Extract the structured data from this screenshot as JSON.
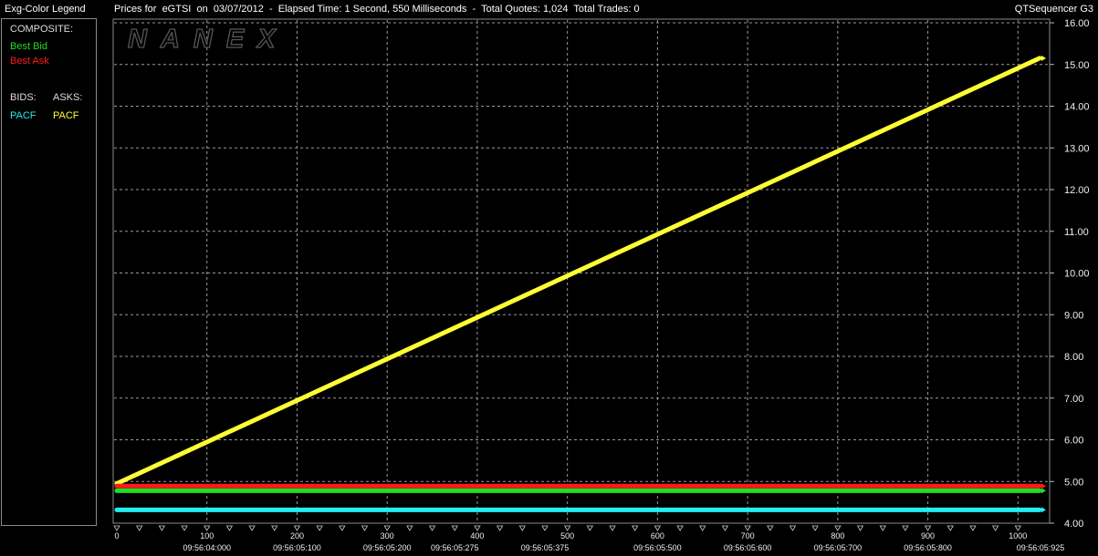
{
  "header": {
    "legend_title": "Exg-Color Legend",
    "chart_title": "Prices for  eGTSI  on  03/07/2012  -  Elapsed Time: 1 Second, 550 Milliseconds  -  Total Quotes: 1,024  Total Trades: 0",
    "app_name": "QTSequencer G3"
  },
  "legend": {
    "composite_label": "COMPOSITE:",
    "best_bid": "Best Bid",
    "best_ask": "Best Ask",
    "bids_label": "BIDS:",
    "asks_label": "ASKS:",
    "bid_exchange": "PACF",
    "ask_exchange": "PACF"
  },
  "watermark": "NANEX",
  "colors": {
    "best_bid": "#22dd22",
    "best_ask": "#ff1a1a",
    "pacf_bid": "#22eeee",
    "pacf_ask": "#ffff33",
    "grid": "#9a9a9a",
    "frame": "#8a8a8a"
  },
  "chart_data": {
    "type": "line",
    "title": "",
    "x_ticks": [
      0,
      100,
      200,
      300,
      400,
      500,
      600,
      700,
      800,
      900,
      1000
    ],
    "x_time_labels": [
      {
        "x": 100,
        "label": "09:56:04:000"
      },
      {
        "x": 200,
        "label": "09:56:05:100"
      },
      {
        "x": 300,
        "label": "09:56:05:200"
      },
      {
        "x": 375,
        "label": "09:56:05:275"
      },
      {
        "x": 475,
        "label": "09:56:05:375"
      },
      {
        "x": 600,
        "label": "09:56:05:500"
      },
      {
        "x": 700,
        "label": "09:56:05:600"
      },
      {
        "x": 800,
        "label": "09:56:05:700"
      },
      {
        "x": 900,
        "label": "09:56:05:800"
      },
      {
        "x": 1025,
        "label": "09:56:05:925"
      }
    ],
    "y_ticks": [
      "4.00",
      "5.00",
      "6.00",
      "7.00",
      "8.00",
      "9.00",
      "10.00",
      "11.00",
      "12.00",
      "13.00",
      "14.00",
      "15.00",
      "16.00"
    ],
    "xlim": [
      0,
      1024
    ],
    "ylim": [
      4.0,
      16.0
    ],
    "grid": true,
    "series": [
      {
        "name": "PACF",
        "role": "ask",
        "color": "#ffff33",
        "x": [
          0,
          1024
        ],
        "y": [
          4.95,
          15.15
        ]
      },
      {
        "name": "Best Ask",
        "role": "composite-ask",
        "color": "#ff1a1a",
        "x": [
          0,
          1024
        ],
        "y": [
          4.89,
          4.89
        ]
      },
      {
        "name": "Best Bid",
        "role": "composite-bid",
        "color": "#22dd22",
        "x": [
          0,
          1024
        ],
        "y": [
          4.78,
          4.78
        ]
      },
      {
        "name": "PACF",
        "role": "bid",
        "color": "#22eeee",
        "x": [
          0,
          1024
        ],
        "y": [
          4.32,
          4.32
        ]
      }
    ]
  }
}
